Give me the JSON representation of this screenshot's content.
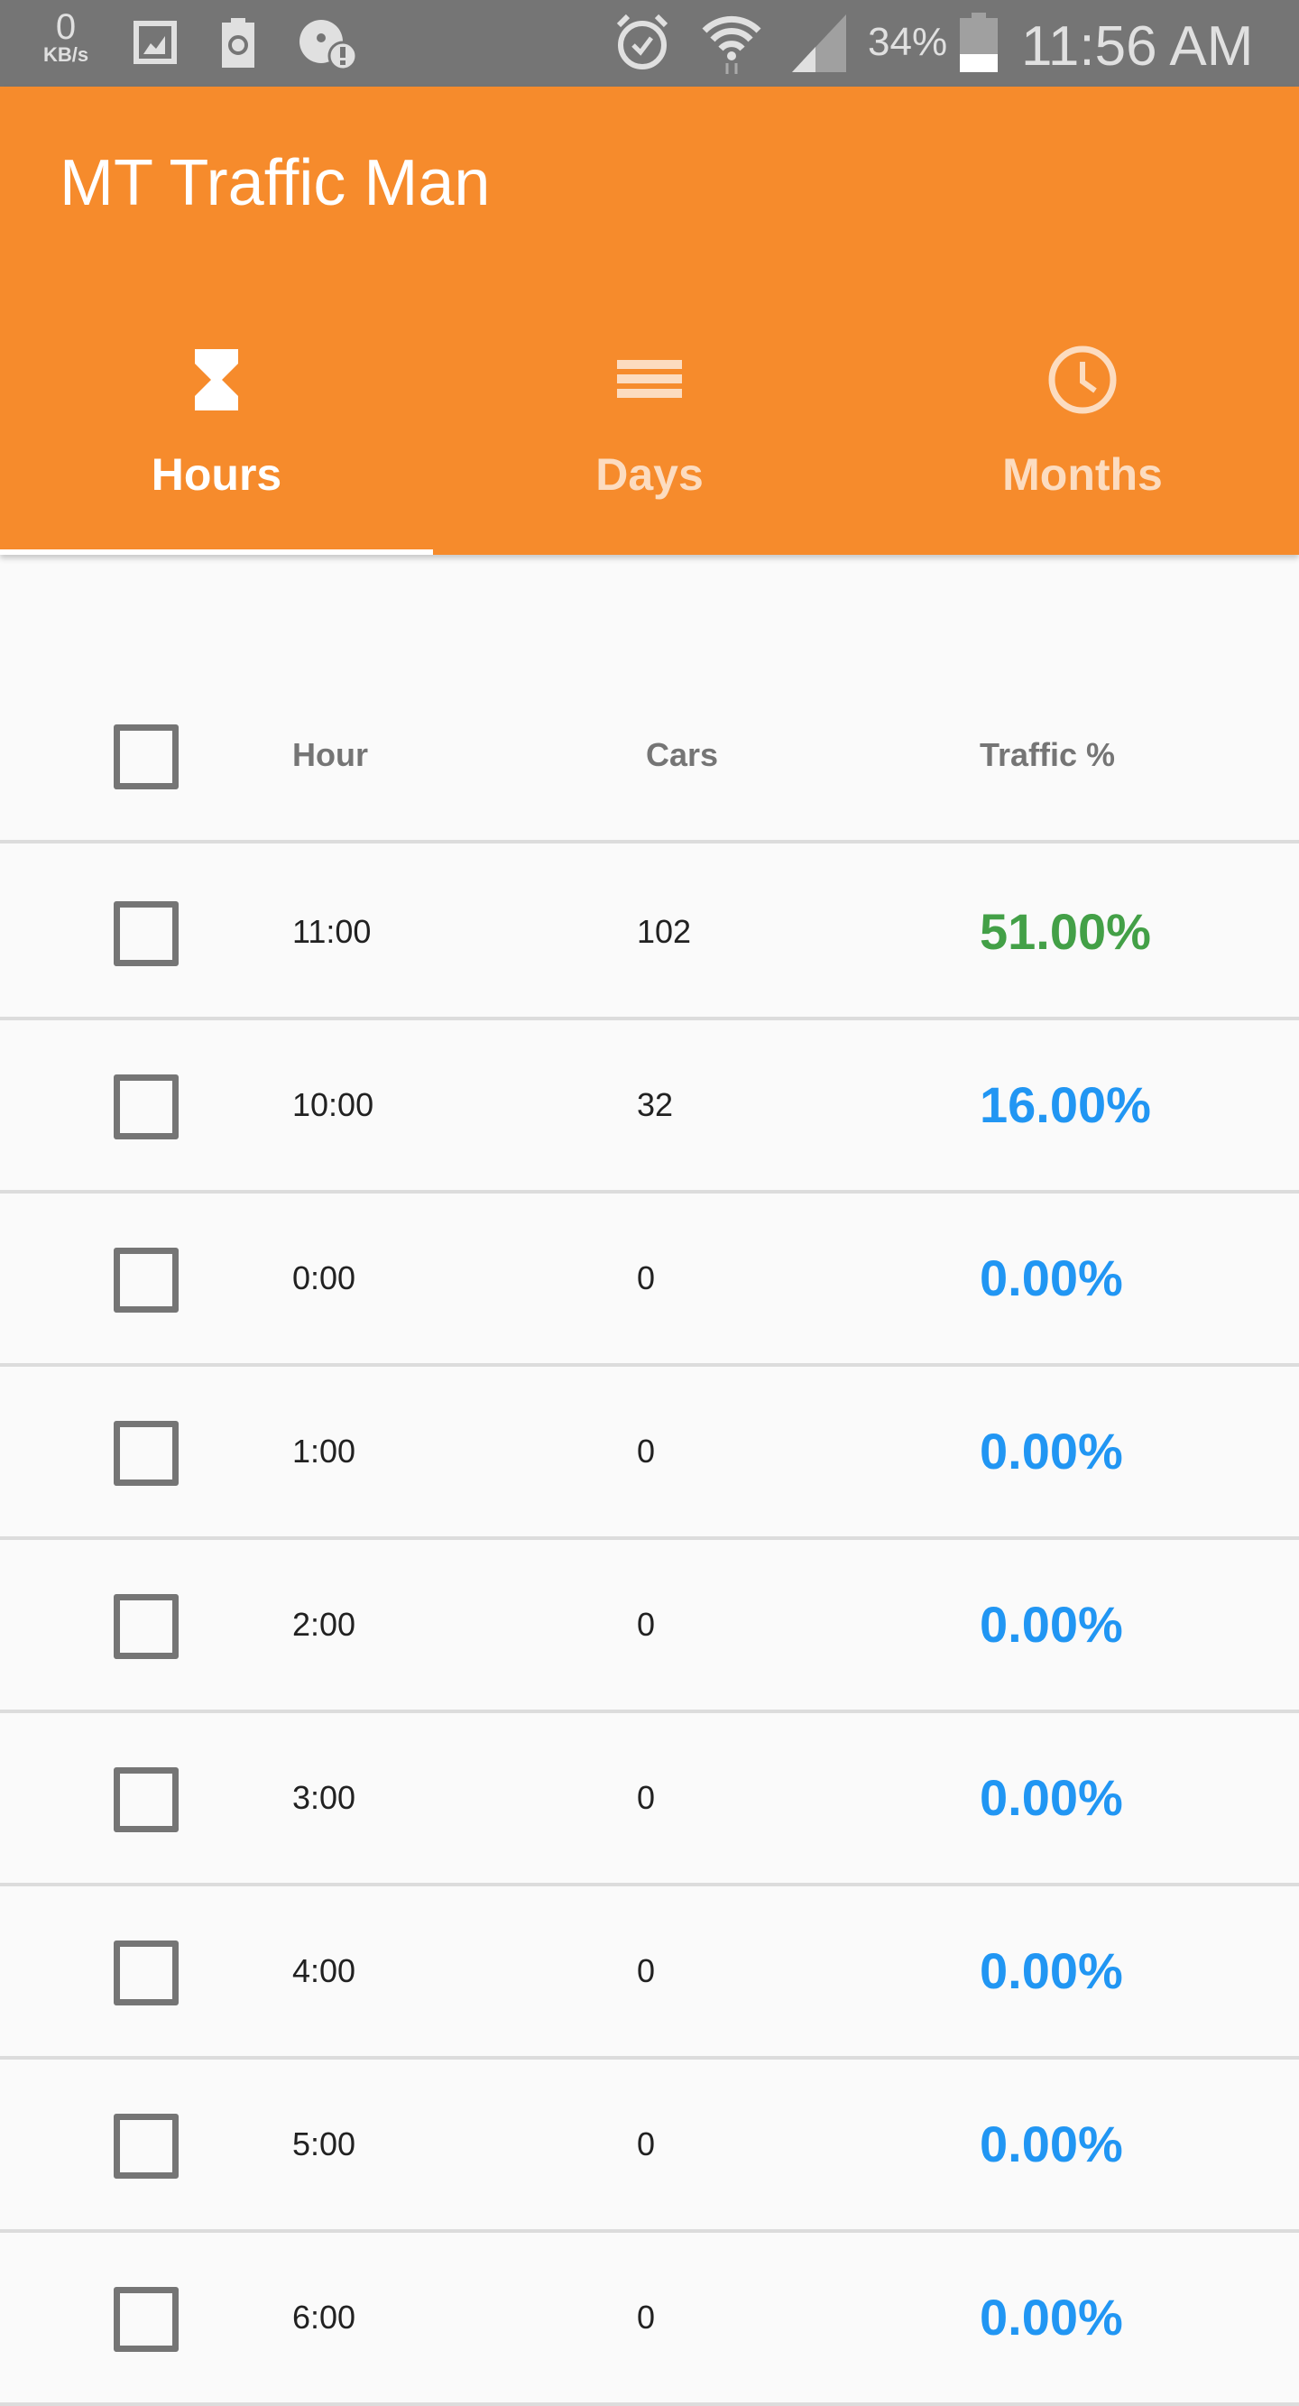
{
  "status_bar": {
    "speed_value": "0",
    "speed_unit": "KB/s",
    "battery": "34%",
    "time": "11:56 AM"
  },
  "app": {
    "title": "MT Traffic Man"
  },
  "tabs": [
    {
      "label": "Hours",
      "icon": "hourglass-icon",
      "active": true
    },
    {
      "label": "Days",
      "icon": "list-icon",
      "active": false
    },
    {
      "label": "Months",
      "icon": "clock-icon",
      "active": false
    }
  ],
  "table": {
    "headers": {
      "hour": "Hour",
      "cars": "Cars",
      "traffic": "Traffic %"
    },
    "rows": [
      {
        "hour": "11:00",
        "cars": "102",
        "traffic": "51.00%",
        "color": "#43a047"
      },
      {
        "hour": "10:00",
        "cars": "32",
        "traffic": "16.00%",
        "color": "#2196f3"
      },
      {
        "hour": "0:00",
        "cars": "0",
        "traffic": "0.00%",
        "color": "#2196f3"
      },
      {
        "hour": "1:00",
        "cars": "0",
        "traffic": "0.00%",
        "color": "#2196f3"
      },
      {
        "hour": "2:00",
        "cars": "0",
        "traffic": "0.00%",
        "color": "#2196f3"
      },
      {
        "hour": "3:00",
        "cars": "0",
        "traffic": "0.00%",
        "color": "#2196f3"
      },
      {
        "hour": "4:00",
        "cars": "0",
        "traffic": "0.00%",
        "color": "#2196f3"
      },
      {
        "hour": "5:00",
        "cars": "0",
        "traffic": "0.00%",
        "color": "#2196f3"
      },
      {
        "hour": "6:00",
        "cars": "0",
        "traffic": "0.00%",
        "color": "#2196f3"
      }
    ]
  }
}
